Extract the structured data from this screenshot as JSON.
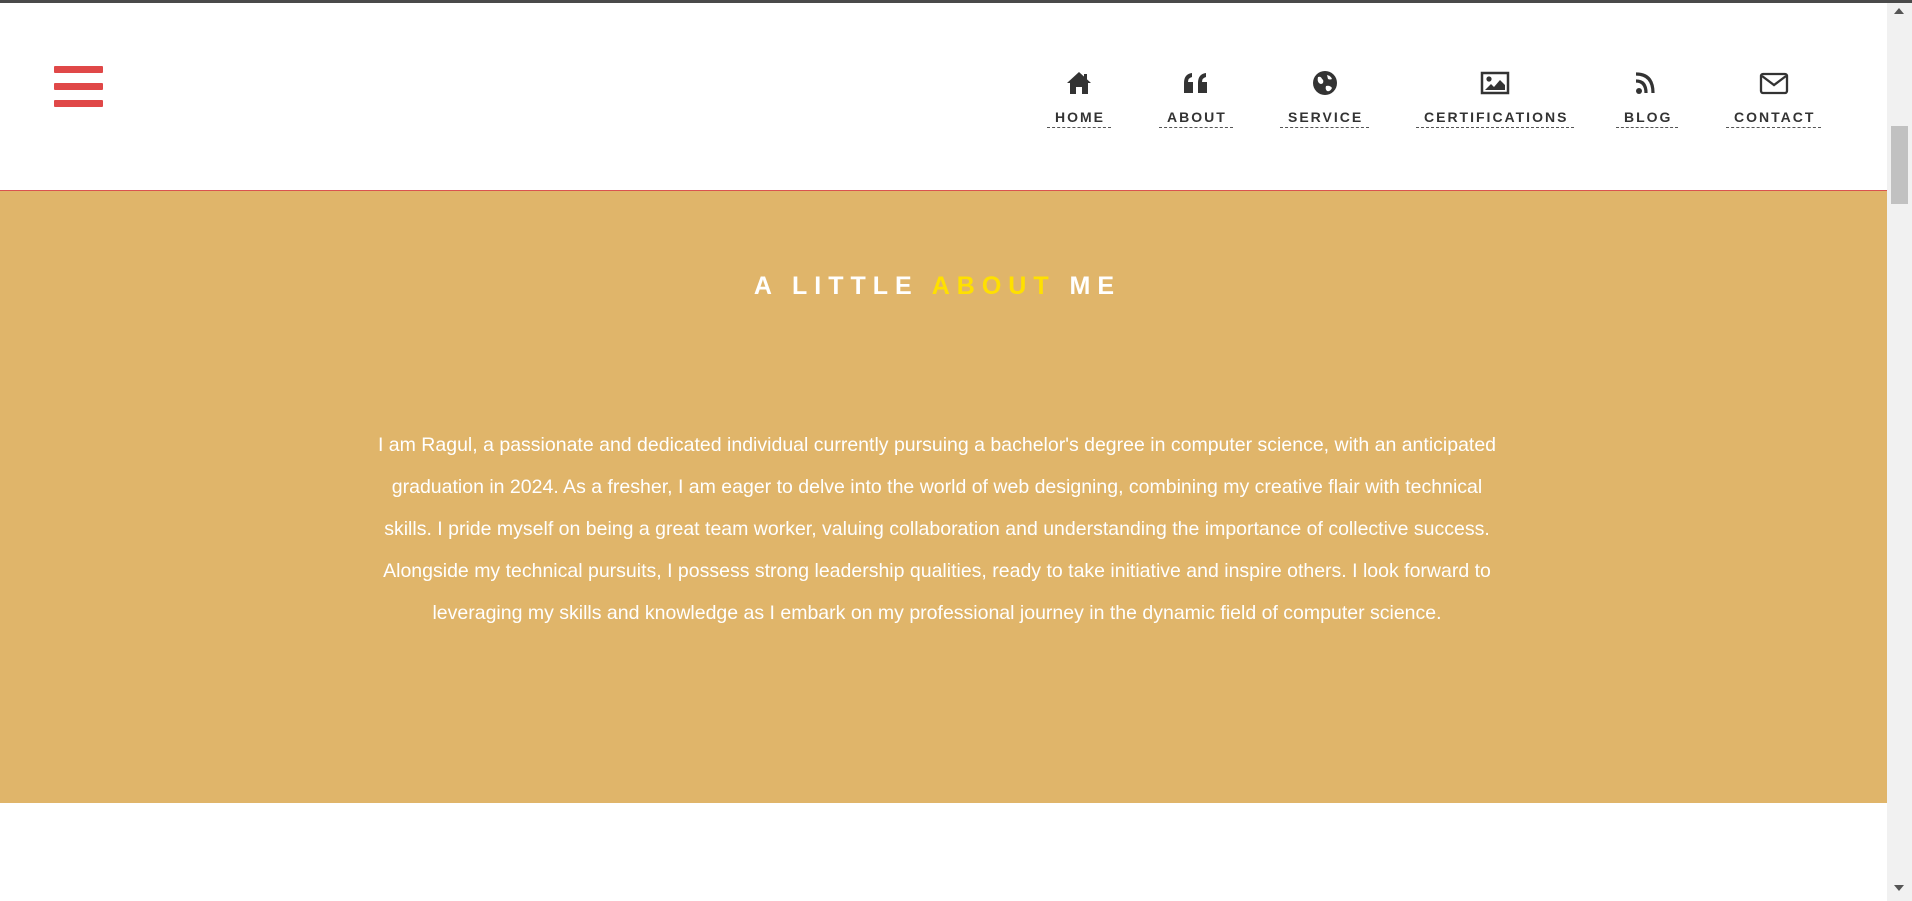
{
  "nav": {
    "items": [
      {
        "label": "HOME",
        "icon": "home-icon"
      },
      {
        "label": "ABOUT",
        "icon": "quote-icon"
      },
      {
        "label": "SERVICE",
        "icon": "globe-icon"
      },
      {
        "label": "CERTIFICATIONS",
        "icon": "image-icon"
      },
      {
        "label": "BLOG",
        "icon": "rss-icon"
      },
      {
        "label": "CONTACT",
        "icon": "envelope-icon"
      }
    ]
  },
  "menu": {
    "icon": "hamburger-menu-icon"
  },
  "about": {
    "title_part1": "A LITTLE ",
    "title_accent": "ABOUT",
    "title_part2": " ME",
    "text": "I am Ragul, a passionate and dedicated individual currently pursuing a bachelor's degree in computer science, with an anticipated graduation in 2024. As a fresher, I am eager to delve into the world of web designing, combining my creative flair with technical skills. I pride myself on being a great team worker, valuing collaboration and understanding the importance of collective success. Alongside my technical pursuits, I possess strong leadership qualities, ready to take initiative and inspire others. I look forward to leveraging my skills and knowledge as I embark on my professional journey in the dynamic field of computer science."
  },
  "colors": {
    "accent": "#e04848",
    "about_background": "#e0b56a",
    "title_accent": "#ffe000",
    "nav_text": "#333333"
  }
}
